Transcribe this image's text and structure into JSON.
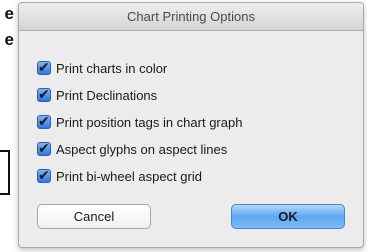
{
  "background": {
    "partial_text_1": "e",
    "partial_text_2": "e"
  },
  "dialog": {
    "title": "Chart Printing Options",
    "options": [
      {
        "label": "Print charts in color",
        "checked": true
      },
      {
        "label": "Print Declinations",
        "checked": true
      },
      {
        "label": "Print position tags in chart graph",
        "checked": true
      },
      {
        "label": "Aspect glyphs on aspect lines",
        "checked": true
      },
      {
        "label": "Print bi-wheel aspect grid",
        "checked": true
      }
    ],
    "cancel_label": "Cancel",
    "ok_label": "OK",
    "check_glyph": "✔"
  },
  "colors": {
    "checkbox_fill": "#2f77e0",
    "default_button": "#5ea7f2"
  }
}
